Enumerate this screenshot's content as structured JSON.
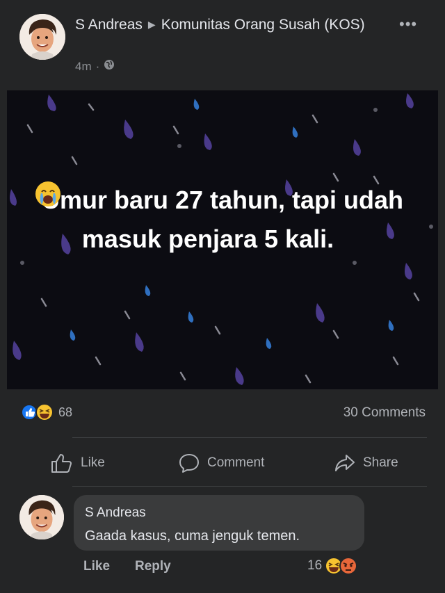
{
  "post": {
    "author": "S Andreas",
    "group": "Komunitas Orang Susah (KOS)",
    "time": "4m",
    "separator": "·",
    "privacy_icon": "globe-icon",
    "more_icon": "more-icon",
    "more_label": "•••",
    "image_text": "Umur baru 27 tahun, tapi udah masuk penjara 5 kali.",
    "reaction_icons": [
      "like-reaction-icon",
      "haha-reaction-icon"
    ],
    "reaction_count": "68",
    "comments_count": "30 Comments"
  },
  "actions": {
    "like": "Like",
    "comment": "Comment",
    "share": "Share"
  },
  "comment": {
    "author": "S Andreas",
    "text": "Gaada kasus, cuma jenguk temen.",
    "like": "Like",
    "reply": "Reply",
    "reaction_count": "16",
    "reaction_icons": [
      "haha-reaction-icon",
      "angry-reaction-icon"
    ]
  },
  "colors": {
    "background": "#242526",
    "bubble": "#3a3b3c",
    "like_blue": "#1877f2",
    "haha_yellow": "#f7c330",
    "angry_orange": "#e8673a",
    "raindrop_purple": "#4a3a8a"
  }
}
